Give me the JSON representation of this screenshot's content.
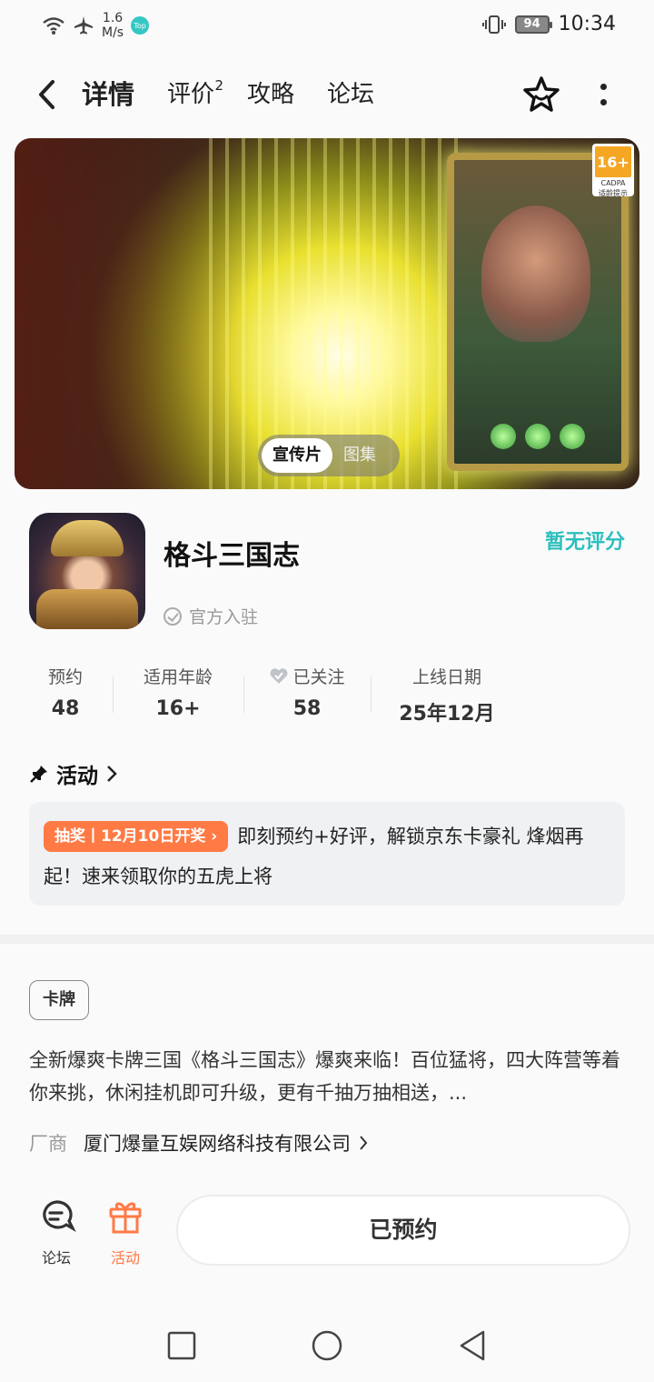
{
  "status_bar": {
    "speed_value": "1.6",
    "speed_unit": "M/s",
    "badge": "Top",
    "battery": "94",
    "time": "10:34"
  },
  "nav": {
    "tabs": [
      {
        "label": "详情",
        "active": true
      },
      {
        "label": "评价",
        "count": "2"
      },
      {
        "label": "攻略"
      },
      {
        "label": "论坛"
      }
    ]
  },
  "banner": {
    "age_rating": "16+",
    "age_org": "CADPA",
    "age_note": "适龄提示",
    "media_tabs": [
      "宣传片",
      "图集"
    ]
  },
  "game": {
    "title": "格斗三国志",
    "official": "官方入驻",
    "rating": "暂无评分"
  },
  "stats": [
    {
      "label": "预约",
      "value": "48"
    },
    {
      "label": "适用年龄",
      "value": "16+"
    },
    {
      "label": "已关注",
      "value": "58"
    },
    {
      "label": "上线日期",
      "value": "25年12月"
    }
  ],
  "activity": {
    "heading": "活动",
    "tag": "抽奖丨12月10日开奖",
    "text": "即刻预约+好评，解锁京东卡豪礼 烽烟再起！速来领取你的五虎上将"
  },
  "details": {
    "tag": "卡牌",
    "description": "全新爆爽卡牌三国《格斗三国志》爆爽来临！百位猛将，四大阵营等着你来挑，休闲挂机即可升级，更有千抽万抽相送，...",
    "vendor_label": "厂商",
    "vendor_name": "厦门爆量互娱网络科技有限公司"
  },
  "bottom_bar": {
    "forum": "论坛",
    "activity": "活动",
    "reserve": "已预约"
  },
  "colors": {
    "accent": "#2cc5c4",
    "orange": "#ff7a45"
  }
}
